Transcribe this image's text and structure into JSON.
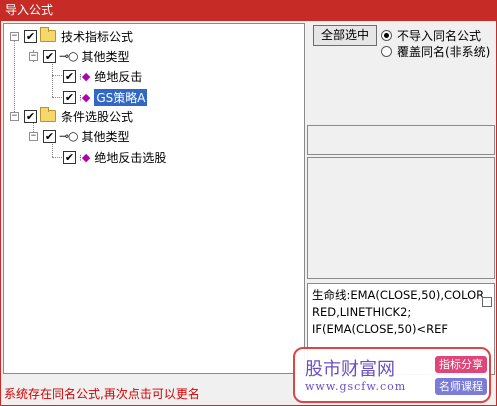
{
  "window": {
    "title": "导入公式"
  },
  "tree": {
    "nodes": [
      {
        "label": "技术指标公式",
        "checked": true,
        "expanded": true
      },
      {
        "label": "其他类型",
        "checked": true,
        "expanded": true
      },
      {
        "label": "绝地反击",
        "checked": true
      },
      {
        "label": "GS策略A",
        "checked": true,
        "selected": true
      },
      {
        "label": "条件选股公式",
        "checked": true,
        "expanded": true
      },
      {
        "label": "其他类型",
        "checked": true,
        "expanded": true
      },
      {
        "label": "绝地反击选股",
        "checked": true
      }
    ]
  },
  "right": {
    "select_all_label": "全部选中",
    "radio_options": [
      {
        "label": "不导入同名公式",
        "selected": true
      },
      {
        "label": "覆盖同名(非系统)",
        "selected": false
      }
    ],
    "code_text": "生命线:EMA(CLOSE,50),COLORRED,LINETHICK2;\nIF(EMA(CLOSE,50)<REF"
  },
  "status_text": "系统存在同名公式,再次点击可以更名",
  "watermark": {
    "site_name": "股市财富网",
    "url": "www.gscfw.com",
    "tag1": "指标分享",
    "tag2": "名师课程"
  },
  "colors": {
    "titlebar": "#c62b26",
    "selection": "#3168c6",
    "status": "#d40000"
  }
}
